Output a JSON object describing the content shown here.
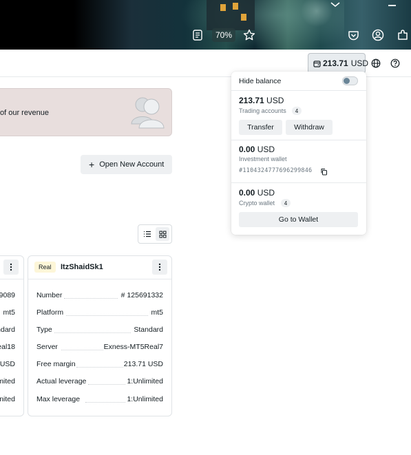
{
  "browser": {
    "zoom": "70%"
  },
  "header": {
    "balance_amount": "213.71",
    "balance_currency": "USD"
  },
  "banner": {
    "text": "of our revenue"
  },
  "open_account_label": "Open New Account",
  "balance_popover": {
    "hide_balance_label": "Hide balance",
    "hide_balance_on": false,
    "trading": {
      "amount": "213.71",
      "currency": "USD",
      "label": "Trading accounts",
      "count": "4",
      "transfer_label": "Transfer",
      "withdraw_label": "Withdraw"
    },
    "investment": {
      "amount": "0.00",
      "currency": "USD",
      "label": "Investment wallet",
      "id": "#1104324777696299846"
    },
    "crypto": {
      "amount": "0.00",
      "currency": "USD",
      "label": "Crypto wallet",
      "count": "4",
      "button_label": "Go to Wallet"
    }
  },
  "account_card": {
    "badge": "Real",
    "name": "ItzShaidSk1",
    "rows": [
      {
        "label": "Number",
        "value": "# 125691332"
      },
      {
        "label": "Platform",
        "value": "mt5"
      },
      {
        "label": "Type",
        "value": "Standard"
      },
      {
        "label": "Server",
        "value": "Exness-MT5Real7"
      },
      {
        "label": "Free margin",
        "value": "213.71 USD"
      },
      {
        "label": "Actual leverage",
        "value": "1:Unlimited"
      },
      {
        "label": "Max leverage",
        "value": "1:Unlimited"
      }
    ]
  },
  "partial_card_values": [
    "9089",
    "mt5",
    "andard",
    "eal18",
    "USD",
    "mited",
    "nited"
  ],
  "colors": {
    "accent_badge": "#fdf6d8",
    "banner_bg": "#e8dedd",
    "toggle_knob": "#6a8597",
    "button_bg": "#eef0f2"
  }
}
